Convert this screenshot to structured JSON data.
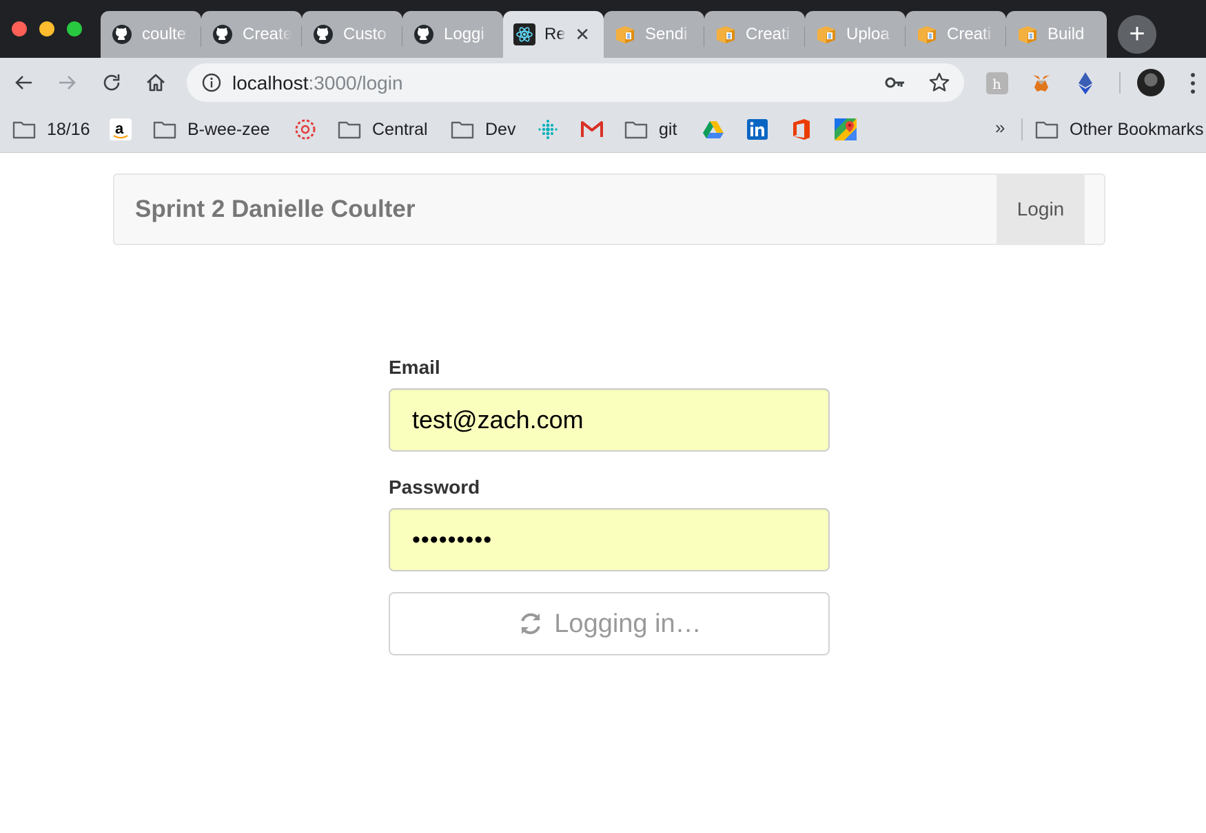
{
  "browser": {
    "tabs": [
      {
        "title": "coulte",
        "icon": "github-icon"
      },
      {
        "title": "Create",
        "icon": "github-icon"
      },
      {
        "title": "Custo",
        "icon": "github-icon"
      },
      {
        "title": "Loggi",
        "icon": "github-icon"
      },
      {
        "title": "Re",
        "icon": "react-icon",
        "active": true
      },
      {
        "title": "Sendi",
        "icon": "package-icon"
      },
      {
        "title": "Creati",
        "icon": "package-icon"
      },
      {
        "title": "Uploa",
        "icon": "package-icon"
      },
      {
        "title": "Creati",
        "icon": "package-icon"
      },
      {
        "title": "Build",
        "icon": "package-icon"
      }
    ],
    "url": {
      "host": "localhost",
      "path": ":3000/login"
    },
    "bookmarks": [
      {
        "label": "18/16",
        "icon": "folder-icon"
      },
      {
        "label": "",
        "icon": "amazon-icon"
      },
      {
        "label": "B-wee-zee",
        "icon": "folder-icon"
      },
      {
        "label": "",
        "icon": "canvas-icon"
      },
      {
        "label": "Central",
        "icon": "folder-icon"
      },
      {
        "label": "",
        "icon": "fitbit-icon"
      },
      {
        "label": "Dev",
        "icon": "folder-icon"
      },
      {
        "label": "",
        "icon": "gmail-icon"
      },
      {
        "label": "git",
        "icon": "folder-icon"
      },
      {
        "label": "",
        "icon": "google-drive-icon"
      },
      {
        "label": "",
        "icon": "linkedin-icon"
      },
      {
        "label": "",
        "icon": "office-icon"
      },
      {
        "label": "",
        "icon": "google-maps-icon"
      }
    ],
    "overflow": "»",
    "other_bookmarks": "Other Bookmarks"
  },
  "app": {
    "brand": "Sprint 2 Danielle Coulter",
    "nav_login": "Login",
    "form": {
      "email_label": "Email",
      "email_value": "test@zach.com",
      "password_label": "Password",
      "password_value": "•••••••••",
      "submit_label": "Logging in…"
    }
  },
  "colors": {
    "tabstrip": "#202124",
    "toolbar": "#dee1e6",
    "autofill": "#faffbd",
    "navbar_bg": "#f8f8f8"
  }
}
